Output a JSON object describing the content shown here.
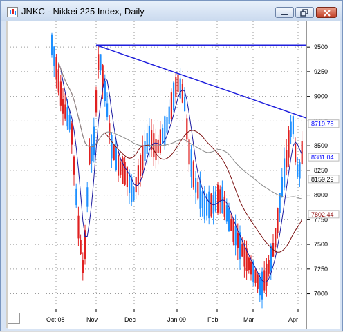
{
  "window": {
    "title": "JNKC - Nikkei 225 Index, Daily",
    "controls": [
      "minimize",
      "restore",
      "close"
    ]
  },
  "chart_data": {
    "type": "candlestick",
    "title": "JNKC - Nikkei 225 Index, Daily",
    "y_ticks": [
      7000,
      7250,
      7500,
      7750,
      8000,
      8250,
      8500,
      8750,
      9000,
      9250,
      9500
    ],
    "x_ticks": [
      "Oct 08",
      "Nov",
      "Dec",
      "Jan 09",
      "Feb",
      "Mar",
      "Apr"
    ],
    "ylim": [
      6850,
      9760
    ],
    "price_markers": [
      {
        "label": "8719.78",
        "value": 8719.78,
        "color": "#0000ff"
      },
      {
        "label": "8381.04",
        "value": 8381.04,
        "color": "#0000ff"
      },
      {
        "label": "8159.29",
        "value": 8159.29,
        "color": "#000000"
      },
      {
        "label": "7802.44",
        "value": 7802.44,
        "color": "#8b0000"
      }
    ],
    "trendlines": [
      {
        "name": "resistance",
        "color": "#1e1edc",
        "from": [
          "Nov",
          9520
        ],
        "to": [
          "Apr",
          8780
        ]
      },
      {
        "name": "horizontal",
        "color": "#1e1edc",
        "from": [
          "Nov",
          9520
        ],
        "to": [
          "Apr",
          9520
        ]
      }
    ],
    "moving_averages": [
      "short (blue)",
      "medium (dark red)",
      "long (gray)"
    ],
    "grid": true,
    "up_color": "#1e90ff",
    "down_color": "#e02020"
  }
}
